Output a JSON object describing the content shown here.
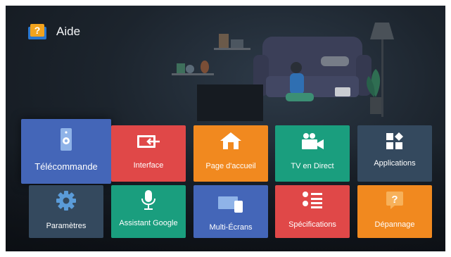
{
  "header": {
    "title": "Aide",
    "icon": "help-book-icon"
  },
  "tiles": [
    {
      "label": "Télécommande",
      "icon": "remote-icon",
      "color": "#4466b8"
    },
    {
      "label": "Interface",
      "icon": "input-source-icon",
      "color": "#e04848"
    },
    {
      "label": "Page d'accueil",
      "icon": "home-icon",
      "color": "#f1891f"
    },
    {
      "label": "TV en Direct",
      "icon": "camera-icon",
      "color": "#1a9e7e"
    },
    {
      "label": "Applications",
      "icon": "apps-icon",
      "color": "#34495e"
    },
    {
      "label": "Paramètres",
      "icon": "gear-icon",
      "color": "#34495e"
    },
    {
      "label": "Assistant Google",
      "icon": "microphone-icon",
      "color": "#1a9e7e"
    },
    {
      "label": "Multi-Écrans",
      "icon": "multi-screen-icon",
      "color": "#4466b8"
    },
    {
      "label": "Spécifications",
      "icon": "list-icon",
      "color": "#e04848"
    },
    {
      "label": "Dépannage",
      "icon": "help-icon",
      "color": "#f1891f"
    }
  ]
}
